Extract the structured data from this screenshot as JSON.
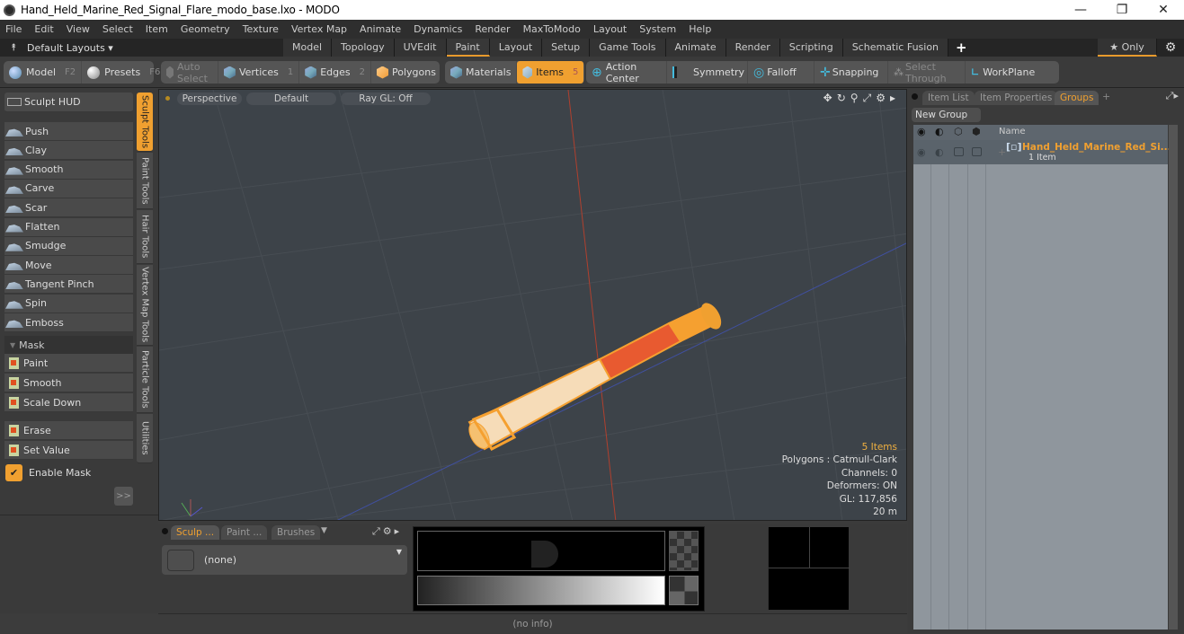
{
  "window": {
    "title": "Hand_Held_Marine_Red_Signal_Flare_modo_base.lxo - MODO",
    "controls": {
      "minimize": "—",
      "restore": "❐",
      "close": "✕"
    }
  },
  "menubar": [
    "File",
    "Edit",
    "View",
    "Select",
    "Item",
    "Geometry",
    "Texture",
    "Vertex Map",
    "Animate",
    "Dynamics",
    "Render",
    "MaxToModo",
    "Layout",
    "System",
    "Help"
  ],
  "layoutbar": {
    "layouts_label": "Default Layouts ▾",
    "tabs": [
      "Model",
      "Topology",
      "UVEdit",
      "Paint",
      "Layout",
      "Setup",
      "Game Tools",
      "Animate",
      "Render",
      "Scripting",
      "Schematic Fusion"
    ],
    "active_tab": "Paint",
    "add_label": "+",
    "only_label": "★ Only",
    "gear": "⚙"
  },
  "toolbar": {
    "model": {
      "label": "Model",
      "key": "F2"
    },
    "presets": {
      "label": "Presets",
      "key": "F6"
    },
    "auto_select": "Auto Select",
    "vertices": {
      "label": "Vertices",
      "key": "1"
    },
    "edges": {
      "label": "Edges",
      "key": "2"
    },
    "polygons": "Polygons",
    "materials": "Materials",
    "items": {
      "label": "Items",
      "key": "5"
    },
    "action_center": "Action Center",
    "symmetry": "Symmetry",
    "falloff": "Falloff",
    "snapping": "Snapping",
    "select_through": "Select Through",
    "workplane": "WorkPlane"
  },
  "leftpanel": {
    "sculpt_hud": "Sculpt HUD",
    "tools": [
      "Push",
      "Clay",
      "Smooth",
      "Carve",
      "Scar",
      "Flatten",
      "Smudge",
      "Move",
      "Tangent Pinch",
      "Spin",
      "Emboss"
    ],
    "mask_header": "Mask",
    "mask_tools": [
      "Paint",
      "Smooth",
      "Scale Down"
    ],
    "mask_tools2": [
      "Erase",
      "Set Value"
    ],
    "enable_mask": "Enable Mask",
    "enable_mask_checked": true,
    "expand": ">>",
    "vertical_tabs": [
      "Sculpt Tools",
      "Paint Tools",
      "Hair Tools",
      "Vertex Map Tools",
      "Particle Tools",
      "Utilities"
    ],
    "active_vertical_tab": "Sculpt Tools"
  },
  "viewport": {
    "view": "Perspective",
    "shading": "Default",
    "raygl": "Ray GL: Off",
    "info": {
      "items": "5 Items",
      "polygons": "Polygons : Catmull-Clark",
      "channels": "Channels: 0",
      "deformers": "Deformers: ON",
      "gl": "GL: 117,856",
      "scale": "20 m"
    }
  },
  "rightpanel": {
    "tabs": [
      "Item List",
      "Item Properties",
      "Groups"
    ],
    "active_tab": "Groups",
    "add": "+",
    "new_group": "New Group",
    "column_name": "Name",
    "group": {
      "name": "Hand_Held_Marine_Red_Si...",
      "count": "1 Item"
    }
  },
  "bottompanel": {
    "tabs": [
      "Sculp ...",
      "Paint ...",
      "Brushes"
    ],
    "active_tab": "Sculp ...",
    "brush_value": "(none)"
  },
  "statusbar": {
    "text": "(no info)"
  },
  "colors": {
    "accent": "#f0a030",
    "viewport_bg": "#3d4349",
    "group_bg": "#8f969d"
  }
}
